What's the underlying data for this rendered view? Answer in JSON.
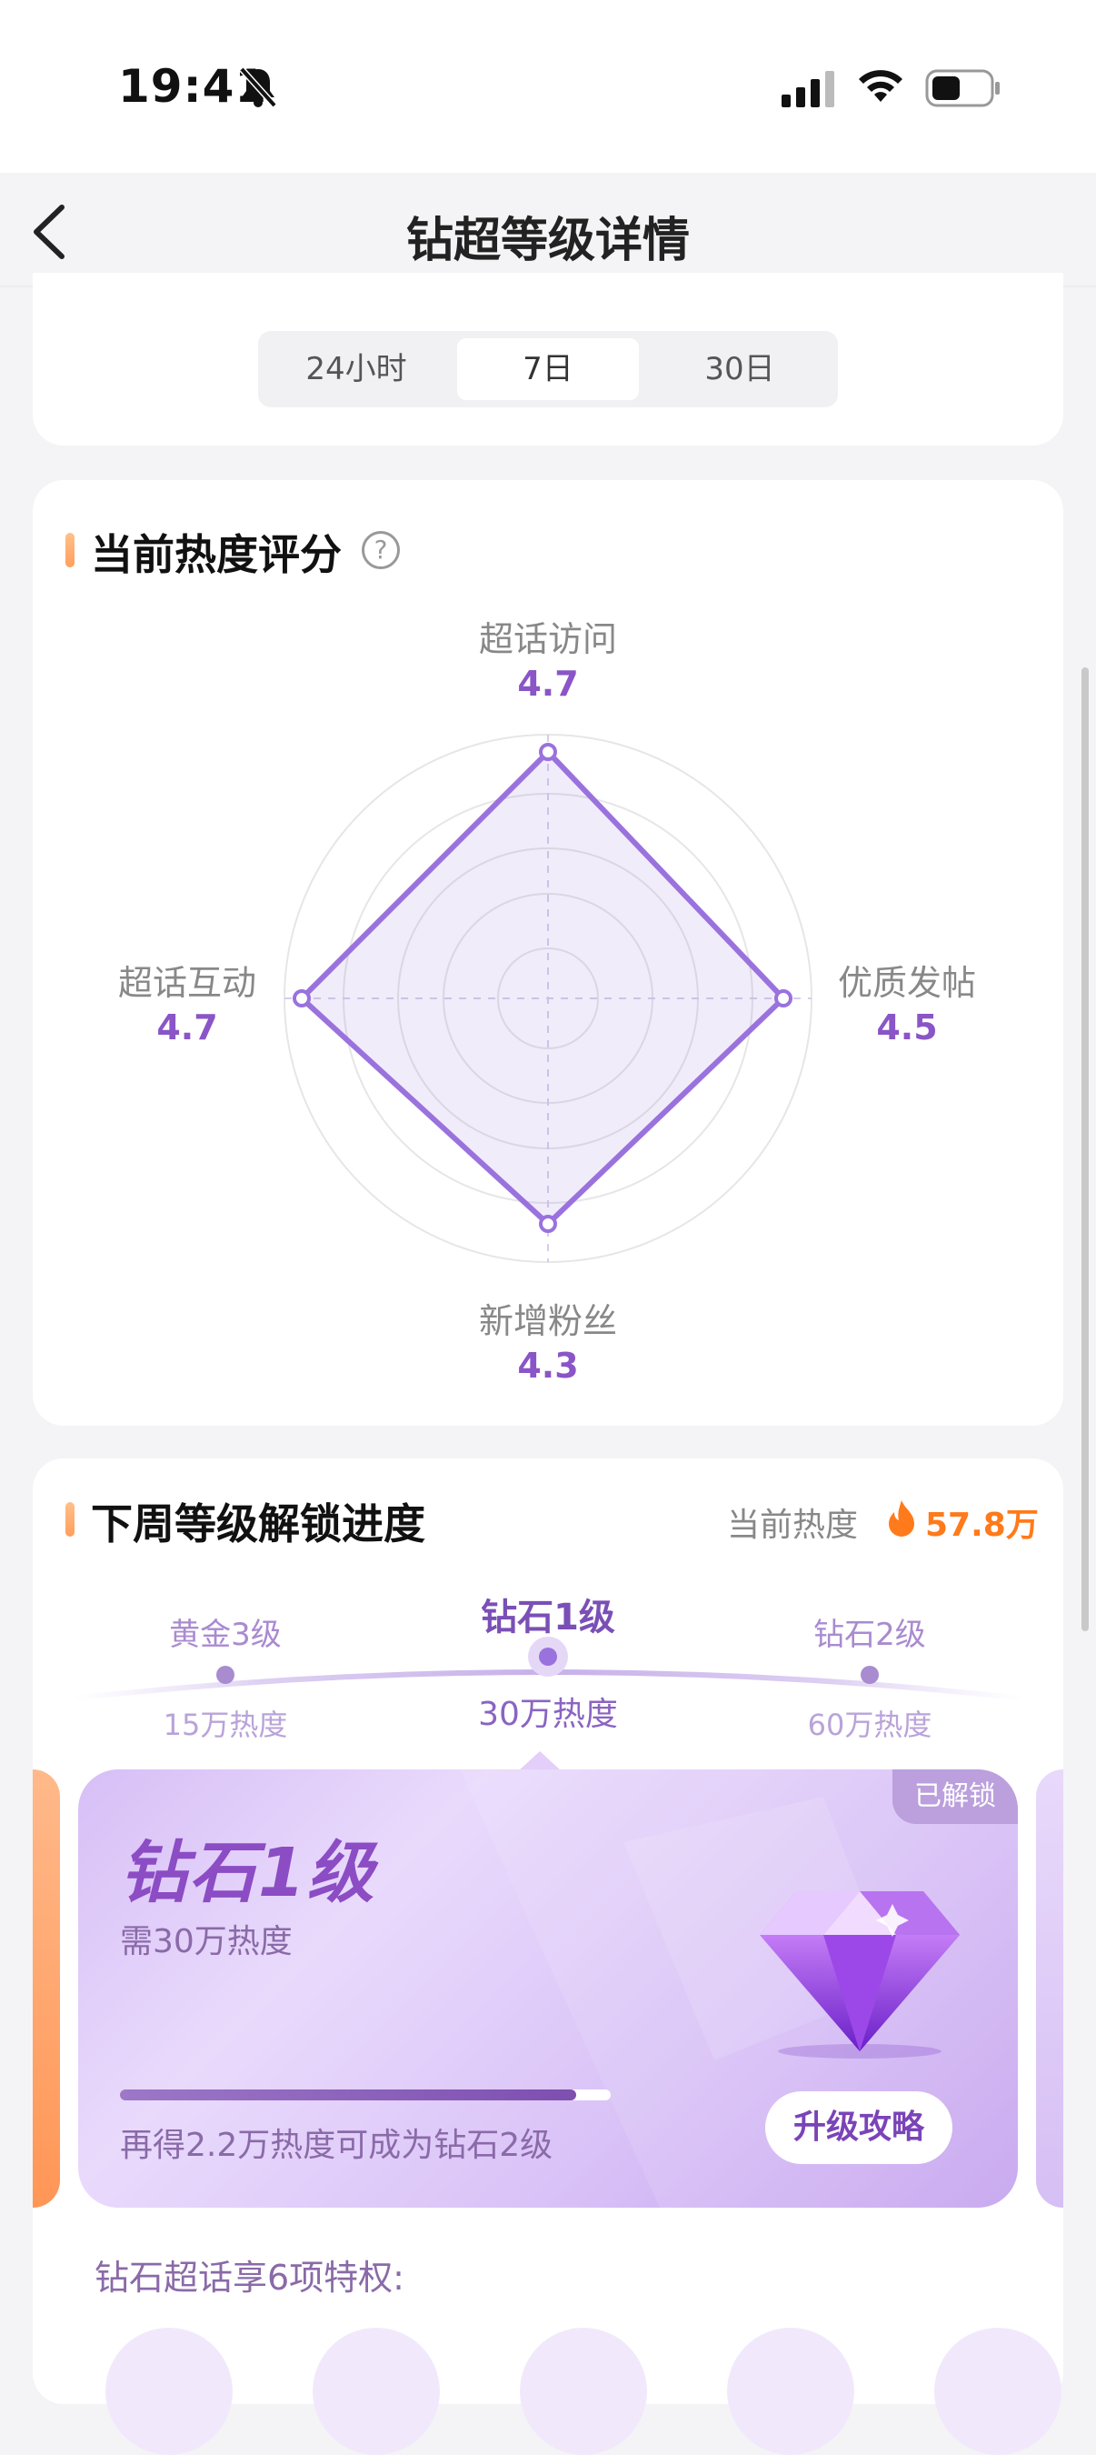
{
  "status_bar": {
    "time": "19:41"
  },
  "nav": {
    "title": "钻超等级详情"
  },
  "segmented": {
    "items": [
      "24小时",
      "7日",
      "30日"
    ],
    "selected": "7日"
  },
  "score": {
    "title": "当前热度评分",
    "help": "?",
    "axes": [
      {
        "label": "超话访问",
        "value": "4.7"
      },
      {
        "label": "优质发帖",
        "value": "4.5"
      },
      {
        "label": "新增粉丝",
        "value": "4.3"
      },
      {
        "label": "超话互动",
        "value": "4.7"
      }
    ]
  },
  "progress": {
    "title": "下周等级解锁进度",
    "heat_label": "当前热度",
    "heat_value": "57.8万",
    "levels": [
      {
        "name": "黄金3级",
        "need": "15万热度"
      },
      {
        "name": "钻石1级",
        "need": "30万热度"
      },
      {
        "name": "钻石2级",
        "need": "60万热度"
      }
    ]
  },
  "level_card": {
    "badge": "已解锁",
    "title": "钻石1级",
    "subtitle": "需30万热度",
    "progress_fraction": 0.93,
    "progress_text": "再得2.2万热度可成为钻石2级",
    "button": "升级攻略"
  },
  "privileges": {
    "title": "钻石超话享6项特权:"
  }
}
